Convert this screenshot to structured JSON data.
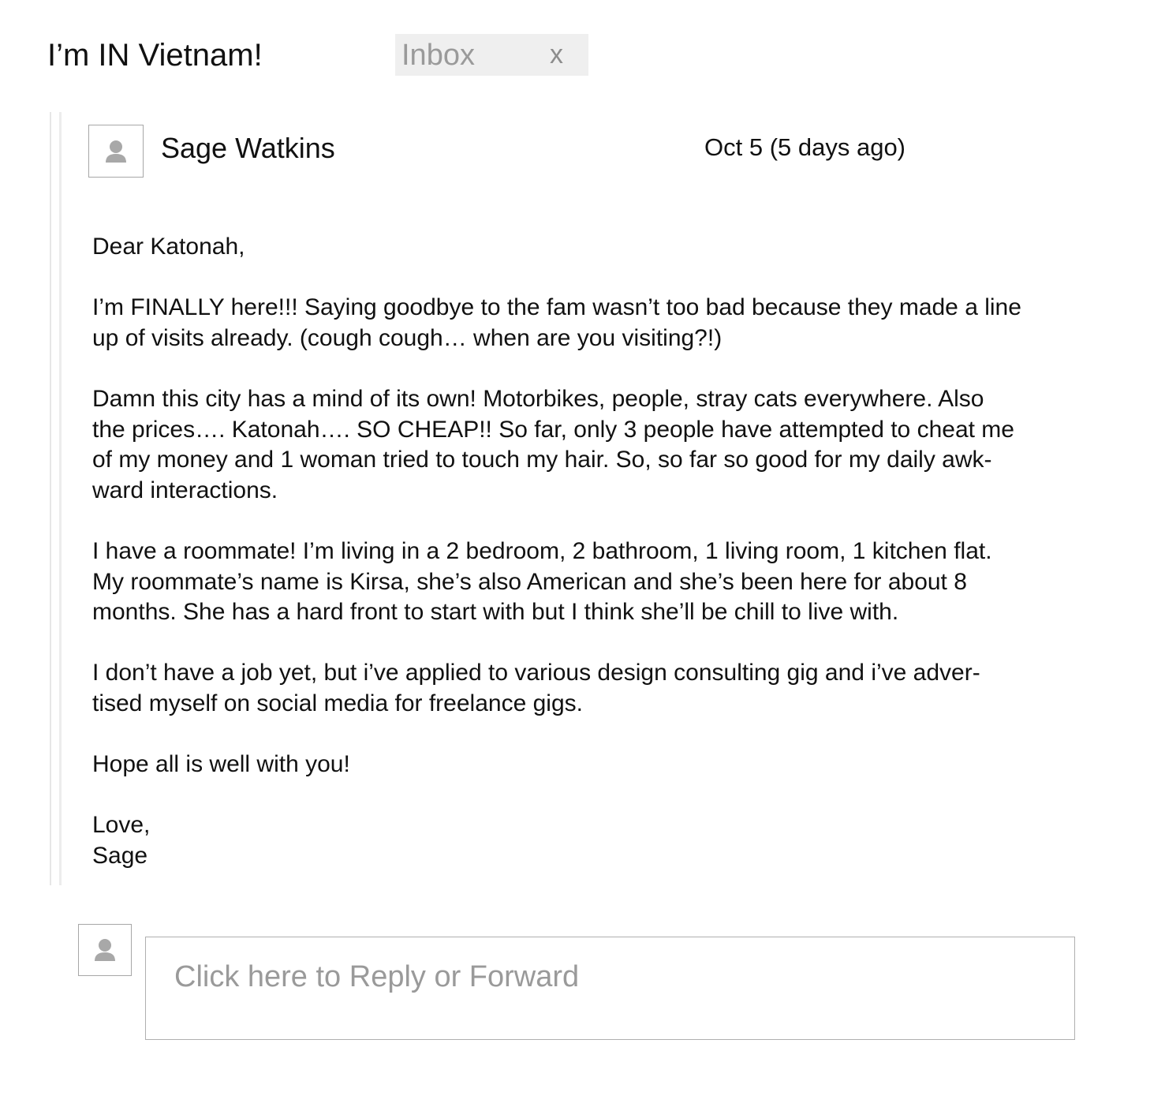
{
  "thread": {
    "subject": "I’m IN Vietnam!",
    "label": {
      "text": "Inbox",
      "close": "x"
    }
  },
  "message": {
    "sender": "Sage Watkins",
    "date": "Oct 5 (5 days ago)",
    "avatar_icon": "person-icon",
    "body": [
      "Dear Katonah,",
      "I’m FINALLY here!!! Saying goodbye to the fam wasn’t too bad because they made a line\nup of visits already. (cough cough… when are you visiting?!)",
      "Damn this city has a mind of its own! Motorbikes, people, stray cats everywhere. Also\nthe prices…. Katonah…. SO CHEAP!! So far, only 3 people have attempted to cheat me\nof my money and 1 woman tried to touch my hair. So, so far so good for my daily awk-\nward interactions.",
      "I have a roommate! I’m living in a 2 bedroom, 2 bathroom, 1 living room, 1 kitchen flat.\nMy roommate’s name is Kirsa, she’s also American and she’s been here for about 8\nmonths. She has a hard front to start with but I think she’ll be chill to live with.",
      "I don’t have a job yet, but i’ve applied to various design consulting gig and i’ve adver-\ntised myself on social media for freelance gigs.",
      "Hope all is well with you!",
      "Love,\nSage"
    ]
  },
  "reply": {
    "placeholder": "Click here to Reply or Forward",
    "avatar_icon": "person-icon"
  },
  "colors": {
    "text": "#111111",
    "muted": "#9a9a9a",
    "chip_bg": "#efefef",
    "border": "#b0b0b0",
    "avatar_glyph": "#a8a8a8"
  }
}
